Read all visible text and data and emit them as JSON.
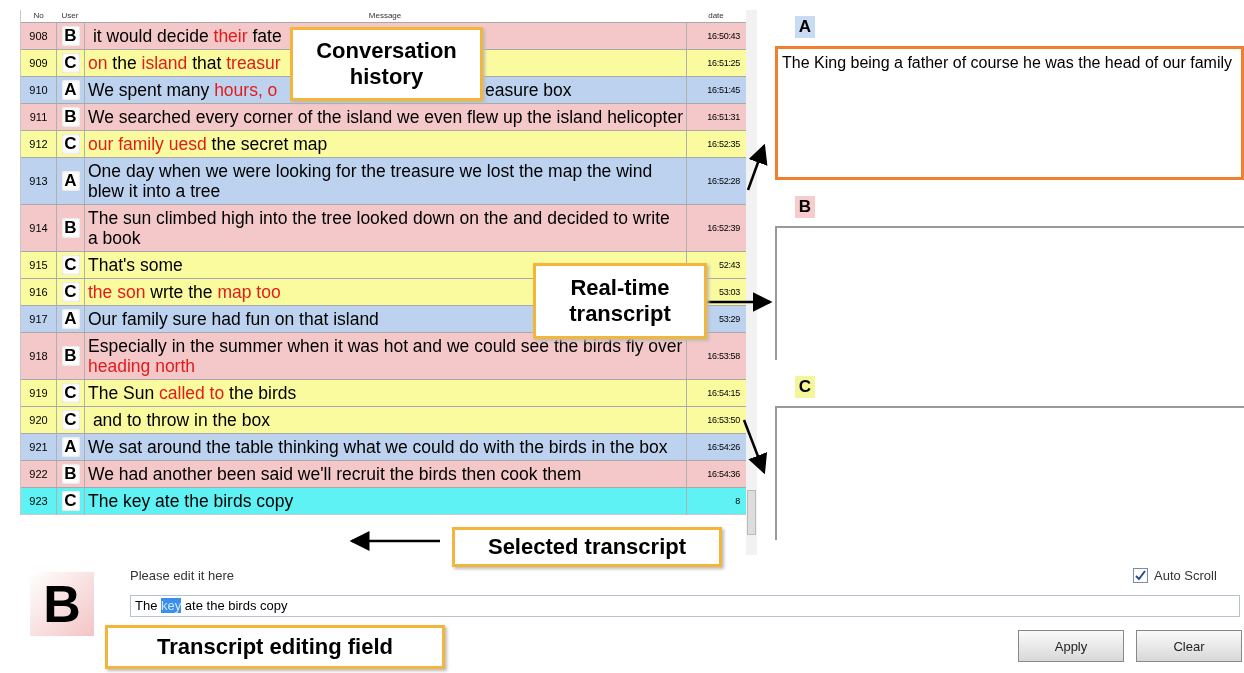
{
  "table": {
    "columns": [
      "No",
      "User",
      "Message",
      "date"
    ],
    "rows": [
      {
        "no": "908",
        "user": "B",
        "color": "#f4c8c8",
        "selected": false,
        "message": [
          {
            "text": " it would decide ",
            "red": false
          },
          {
            "text": "their",
            "red": true
          },
          {
            "text": " fate",
            "red": false
          }
        ],
        "date": "16:50:43"
      },
      {
        "no": "909",
        "user": "C",
        "color": "#fafa9e",
        "selected": false,
        "message": [
          {
            "text": "on",
            "red": true
          },
          {
            "text": " the ",
            "red": false
          },
          {
            "text": "island",
            "red": true
          },
          {
            "text": " that ",
            "red": false
          },
          {
            "text": "treasur",
            "red": true
          }
        ],
        "date": "16:51:25"
      },
      {
        "no": "910",
        "user": "A",
        "color": "#bcd2ef",
        "selected": false,
        "message": [
          {
            "text": "We spent many ",
            "red": false
          },
          {
            "text": "hours, o",
            "red": true
          }
        ],
        "message_tail": "easure box",
        "date": "16:51:45"
      },
      {
        "no": "911",
        "user": "B",
        "color": "#f4c8c8",
        "selected": false,
        "message": [
          {
            "text": "We searched every corner of the island we even flew up the island helicopter",
            "red": false
          }
        ],
        "date": "16:51:31"
      },
      {
        "no": "912",
        "user": "C",
        "color": "#fafa9e",
        "selected": false,
        "message": [
          {
            "text": "our family uesd",
            "red": true
          },
          {
            "text": " the secret map",
            "red": false
          }
        ],
        "date": "16:52:35"
      },
      {
        "no": "913",
        "user": "A",
        "color": "#bcd2ef",
        "selected": false,
        "message": [
          {
            "text": "One day when we were looking for the treasure we lost the map the wind blew it into a tree",
            "red": false
          }
        ],
        "date": "16:52:28"
      },
      {
        "no": "914",
        "user": "B",
        "color": "#f4c8c8",
        "selected": false,
        "message": [
          {
            "text": "The sun climbed high into the tree looked down on the and decided to write a book",
            "red": false
          }
        ],
        "date": "16:52:39"
      },
      {
        "no": "915",
        "user": "C",
        "color": "#fafa9e",
        "selected": false,
        "message": [
          {
            "text": "That's some",
            "red": false
          }
        ],
        "date": "52:43"
      },
      {
        "no": "916",
        "user": "C",
        "color": "#fafa9e",
        "selected": false,
        "message": [
          {
            "text": "the son",
            "red": true
          },
          {
            "text": " wrte the ",
            "red": false
          },
          {
            "text": "map too",
            "red": true
          }
        ],
        "date": "53:03"
      },
      {
        "no": "917",
        "user": "A",
        "color": "#bcd2ef",
        "selected": false,
        "message": [
          {
            "text": "Our family sure had fun on that island",
            "red": false
          }
        ],
        "date": "53:29"
      },
      {
        "no": "918",
        "user": "B",
        "color": "#f4c8c8",
        "selected": false,
        "message": [
          {
            "text": "Especially in the summer when it was hot and we could see the birds fly over ",
            "red": false
          },
          {
            "text": "heading north",
            "red": true
          }
        ],
        "date": "16:53:58"
      },
      {
        "no": "919",
        "user": "C",
        "color": "#fafa9e",
        "selected": false,
        "message": [
          {
            "text": "The Sun ",
            "red": false
          },
          {
            "text": "called to",
            "red": true
          },
          {
            "text": " the birds",
            "red": false
          }
        ],
        "date": "16:54:15"
      },
      {
        "no": "920",
        "user": "C",
        "color": "#fafa9e",
        "selected": false,
        "message": [
          {
            "text": " and to throw in the box",
            "red": false
          }
        ],
        "date": "16:53:50"
      },
      {
        "no": "921",
        "user": "A",
        "color": "#bcd2ef",
        "selected": false,
        "message": [
          {
            "text": "We sat around the table thinking what we could do with the birds in the box",
            "red": false
          }
        ],
        "date": "16:54:26"
      },
      {
        "no": "922",
        "user": "B",
        "color": "#f4c8c8",
        "selected": false,
        "message": [
          {
            "text": "We had another been said we'll recruit the birds then cook them",
            "red": false
          }
        ],
        "date": "16:54:36"
      },
      {
        "no": "923",
        "user": "C",
        "selected": true,
        "message": [
          {
            "text": "The key ate the birds copy",
            "red": false
          }
        ],
        "date": "8"
      }
    ]
  },
  "panels": [
    {
      "user": "A",
      "color": "#c9daf3",
      "active": true,
      "text": "The King being a father of course he was the head of our family"
    },
    {
      "user": "B",
      "color": "#f6cccc",
      "active": false
    },
    {
      "user": "C",
      "color": "#f5f59a",
      "active": false
    }
  ],
  "editor": {
    "user": "B",
    "label": "Please edit it here",
    "value": [
      {
        "text": "The ",
        "selected": false
      },
      {
        "text": "key",
        "selected": true
      },
      {
        "text": " ate the birds copy",
        "selected": false
      }
    ],
    "auto_scroll": {
      "label": "Auto Scroll",
      "checked": true
    },
    "buttons": [
      "Apply",
      "Clear"
    ]
  },
  "callouts": [
    {
      "kind": "history",
      "text": "Conversation history"
    },
    {
      "kind": "realtime",
      "text": "Real-time transcript"
    },
    {
      "kind": "selected",
      "text": "Selected transcript"
    },
    {
      "kind": "editing",
      "text": "Transcript editing field"
    }
  ]
}
